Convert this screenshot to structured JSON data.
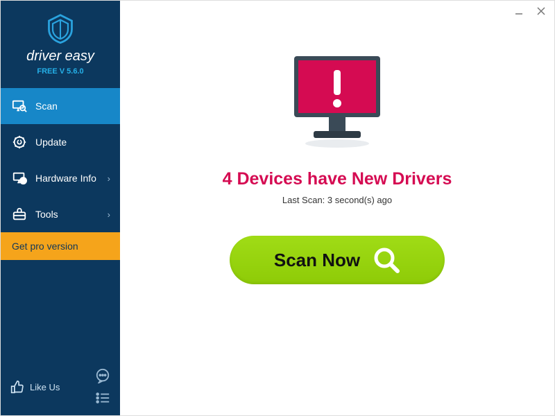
{
  "brand": {
    "name": "driver easy",
    "version": "FREE V 5.6.0"
  },
  "sidebar": {
    "items": [
      {
        "label": "Scan"
      },
      {
        "label": "Update"
      },
      {
        "label": "Hardware Info"
      },
      {
        "label": "Tools"
      }
    ],
    "pro_label": "Get pro version",
    "like_label": "Like Us"
  },
  "main": {
    "headline": "4 Devices have New Drivers",
    "subline": "Last Scan: 3 second(s) ago",
    "scan_button": "Scan Now"
  },
  "colors": {
    "accent": "#d50b52",
    "sidebar": "#0c385e",
    "active": "#1787c8",
    "pro": "#f5a41b",
    "scan": "#98d40c"
  }
}
